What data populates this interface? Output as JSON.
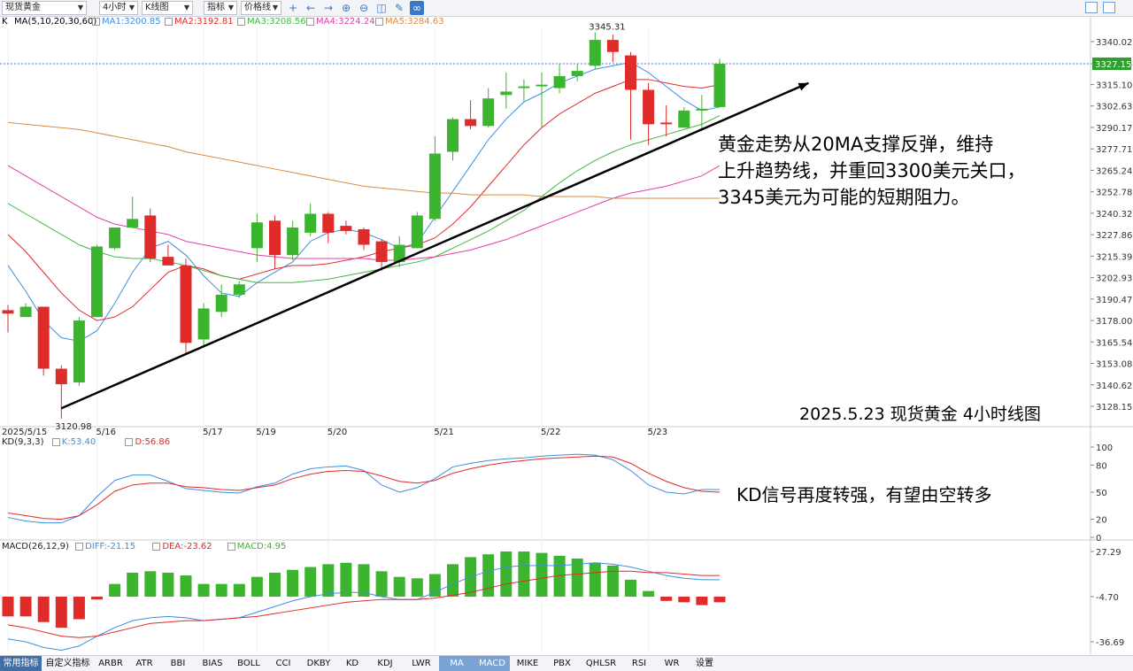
{
  "toolbar": {
    "symbol": "现货黄金",
    "period": "4小时",
    "chart_type": "K线图",
    "indicator": "指标",
    "price_line": "价格线"
  },
  "main_legend": {
    "k_label": "K",
    "ma_title": "MA(5,10,20,30,60)",
    "ma1": "MA1:3200.85",
    "ma2": "MA2:3192.81",
    "ma3": "MA3:3208.56",
    "ma4": "MA4:3224.24",
    "ma5": "MA5:3284.63"
  },
  "kd_legend": {
    "title": "KD(9,3,3)",
    "k": "K:53.40",
    "d": "D:56.86"
  },
  "macd_legend": {
    "title": "MACD(26,12,9)",
    "diff": "DIFF:-21.15",
    "dea": "DEA:-23.62",
    "macd": "MACD:4.95"
  },
  "annotations": {
    "main_text_1": "黄金走势从20MA支撑反弹，维持",
    "main_text_2": "上升趋势线，并重回3300美元关口，",
    "main_text_3": "3345美元为可能的短期阻力。",
    "chart_caption": "2025.5.23 现货黄金 4小时线图",
    "kd_text": "KD信号再度转强，有望由空转多"
  },
  "colors": {
    "up": "#3cb52e",
    "down": "#e02b2b",
    "ma1": "#3d8fe0",
    "ma2": "#e02b2b",
    "ma3": "#43b843",
    "ma4": "#e040a8",
    "ma5": "#d88a40"
  },
  "bottom_tabs": [
    "常用指标",
    "自定义指标",
    "ARBR",
    "ATR",
    "BBI",
    "BIAS",
    "BOLL",
    "CCI",
    "DKBY",
    "KD",
    "KDJ",
    "LWR",
    "MA",
    "MACD",
    "MIKE",
    "PBX",
    "QHLSR",
    "RSI",
    "WR",
    "设置"
  ],
  "chart_data": {
    "type": "candlestick",
    "title": "",
    "price_axis_ticks": [
      3340.02,
      3327.15,
      3315.1,
      3302.63,
      3290.17,
      3277.71,
      3265.24,
      3252.78,
      3240.32,
      3227.86,
      3215.39,
      3202.93,
      3190.47,
      3178.0,
      3165.54,
      3153.08,
      3140.62,
      3128.15
    ],
    "current_price": 3327.15,
    "high_label": "3345.31",
    "low_label": "3120.98",
    "date_labels": [
      {
        "label": "2025/5/15",
        "bar": 0
      },
      {
        "label": "5/16",
        "bar": 5
      },
      {
        "label": "5/17",
        "bar": 11
      },
      {
        "label": "5/19",
        "bar": 14
      },
      {
        "label": "5/20",
        "bar": 18
      },
      {
        "label": "5/21",
        "bar": 24
      },
      {
        "label": "5/22",
        "bar": 30
      },
      {
        "label": "5/23",
        "bar": 36
      }
    ],
    "candles": [
      {
        "o": 3184,
        "h": 3187,
        "l": 3171,
        "c": 3182
      },
      {
        "o": 3180,
        "h": 3188,
        "l": 3180,
        "c": 3186
      },
      {
        "o": 3186,
        "h": 3186,
        "l": 3146,
        "c": 3150
      },
      {
        "o": 3150,
        "h": 3152,
        "l": 3121,
        "c": 3141
      },
      {
        "o": 3142,
        "h": 3180,
        "l": 3140,
        "c": 3178
      },
      {
        "o": 3180,
        "h": 3222,
        "l": 3180,
        "c": 3221
      },
      {
        "o": 3220,
        "h": 3232,
        "l": 3219,
        "c": 3232
      },
      {
        "o": 3232,
        "h": 3250,
        "l": 3232,
        "c": 3237
      },
      {
        "o": 3239,
        "h": 3243,
        "l": 3212,
        "c": 3214
      },
      {
        "o": 3215,
        "h": 3222,
        "l": 3210,
        "c": 3210
      },
      {
        "o": 3210,
        "h": 3214,
        "l": 3158,
        "c": 3165
      },
      {
        "o": 3167,
        "h": 3188,
        "l": 3163,
        "c": 3185
      },
      {
        "o": 3183,
        "h": 3199,
        "l": 3180,
        "c": 3193
      },
      {
        "o": 3193,
        "h": 3201,
        "l": 3191,
        "c": 3199
      },
      {
        "o": 3220,
        "h": 3240,
        "l": 3212,
        "c": 3235
      },
      {
        "o": 3236,
        "h": 3239,
        "l": 3208,
        "c": 3216
      },
      {
        "o": 3216,
        "h": 3236,
        "l": 3213,
        "c": 3232
      },
      {
        "o": 3229,
        "h": 3246,
        "l": 3227,
        "c": 3240
      },
      {
        "o": 3240,
        "h": 3241,
        "l": 3223,
        "c": 3229
      },
      {
        "o": 3233,
        "h": 3236,
        "l": 3228,
        "c": 3230
      },
      {
        "o": 3231,
        "h": 3232,
        "l": 3219,
        "c": 3222
      },
      {
        "o": 3224,
        "h": 3225,
        "l": 3207,
        "c": 3212
      },
      {
        "o": 3212,
        "h": 3227,
        "l": 3209,
        "c": 3222
      },
      {
        "o": 3220,
        "h": 3241,
        "l": 3220,
        "c": 3239
      },
      {
        "o": 3237,
        "h": 3285,
        "l": 3236,
        "c": 3275
      },
      {
        "o": 3276,
        "h": 3296,
        "l": 3271,
        "c": 3295
      },
      {
        "o": 3295,
        "h": 3306,
        "l": 3289,
        "c": 3291
      },
      {
        "o": 3291,
        "h": 3313,
        "l": 3290,
        "c": 3307
      },
      {
        "o": 3309,
        "h": 3322,
        "l": 3301,
        "c": 3311
      },
      {
        "o": 3313,
        "h": 3318,
        "l": 3305,
        "c": 3314
      },
      {
        "o": 3314,
        "h": 3322,
        "l": 3290,
        "c": 3315
      },
      {
        "o": 3313,
        "h": 3327,
        "l": 3310,
        "c": 3320
      },
      {
        "o": 3320,
        "h": 3327,
        "l": 3317,
        "c": 3323
      },
      {
        "o": 3326,
        "h": 3345.31,
        "l": 3324,
        "c": 3341
      },
      {
        "o": 3341,
        "h": 3344,
        "l": 3328,
        "c": 3334
      },
      {
        "o": 3332,
        "h": 3334,
        "l": 3283,
        "c": 3312
      },
      {
        "o": 3312,
        "h": 3316,
        "l": 3280,
        "c": 3292
      },
      {
        "o": 3293,
        "h": 3303,
        "l": 3285,
        "c": 3292
      },
      {
        "o": 3290,
        "h": 3302,
        "l": 3290,
        "c": 3300
      },
      {
        "o": 3300,
        "h": 3309,
        "l": 3288,
        "c": 3301
      },
      {
        "o": 3302,
        "h": 3330,
        "l": 3302,
        "c": 3327.15
      }
    ],
    "ma_series": [
      {
        "name": "MA1",
        "values": [
          3210,
          3195,
          3178,
          3168,
          3166,
          3172,
          3188,
          3206,
          3220,
          3224,
          3216,
          3204,
          3194,
          3192,
          3200,
          3206,
          3212,
          3224,
          3229,
          3231,
          3229,
          3225,
          3220,
          3223,
          3238,
          3253,
          3268,
          3283,
          3295,
          3305,
          3310,
          3316,
          3320,
          3324,
          3326,
          3328,
          3322,
          3314,
          3306,
          3300,
          3302
        ]
      },
      {
        "name": "MA2",
        "values": [
          3228,
          3218,
          3206,
          3194,
          3184,
          3178,
          3180,
          3186,
          3196,
          3206,
          3210,
          3208,
          3204,
          3202,
          3205,
          3208,
          3210,
          3210,
          3211,
          3213,
          3215,
          3218,
          3220,
          3222,
          3226,
          3234,
          3244,
          3256,
          3268,
          3280,
          3290,
          3298,
          3304,
          3310,
          3314,
          3318,
          3318,
          3316,
          3314,
          3313,
          3315
        ]
      },
      {
        "name": "MA3",
        "values": [
          3246,
          3240,
          3234,
          3228,
          3222,
          3218,
          3215,
          3214,
          3214,
          3212,
          3210,
          3207,
          3204,
          3202,
          3200,
          3200,
          3200,
          3201,
          3202,
          3204,
          3206,
          3208,
          3210,
          3212,
          3215,
          3220,
          3225,
          3230,
          3236,
          3242,
          3250,
          3258,
          3265,
          3271,
          3276,
          3280,
          3283,
          3286,
          3289,
          3292,
          3297
        ]
      },
      {
        "name": "MA4",
        "values": [
          3268,
          3262,
          3256,
          3250,
          3244,
          3238,
          3234,
          3232,
          3230,
          3228,
          3224,
          3222,
          3220,
          3218,
          3216,
          3215,
          3214,
          3214,
          3214,
          3214,
          3214,
          3213,
          3213,
          3214,
          3215,
          3217,
          3219,
          3222,
          3225,
          3229,
          3233,
          3237,
          3241,
          3245,
          3249,
          3252,
          3254,
          3256,
          3259,
          3262,
          3268
        ]
      },
      {
        "name": "MA5",
        "values": [
          3293,
          3292,
          3291,
          3290,
          3289,
          3287,
          3285,
          3283,
          3281,
          3279,
          3276,
          3274,
          3272,
          3270,
          3268,
          3266,
          3264,
          3262,
          3260,
          3258,
          3256,
          3255,
          3254,
          3253,
          3252,
          3252,
          3251,
          3251,
          3251,
          3251,
          3250,
          3250,
          3250,
          3250,
          3249,
          3249,
          3249,
          3249,
          3249,
          3249,
          3249
        ]
      }
    ],
    "trendline": {
      "from": {
        "bar": 3,
        "price": 3127
      },
      "to": {
        "bar": 45,
        "price": 3316
      }
    },
    "kd": {
      "yticks": [
        100,
        80,
        50,
        20,
        0
      ],
      "k": [
        22,
        18,
        16,
        16,
        24,
        45,
        63,
        69,
        69,
        62,
        54,
        52,
        50,
        49,
        56,
        60,
        70,
        76,
        78,
        79,
        74,
        58,
        50,
        55,
        65,
        78,
        82,
        85,
        87,
        88,
        90,
        91,
        92,
        91,
        86,
        74,
        58,
        50,
        48,
        53,
        53
      ],
      "d": [
        27,
        24,
        21,
        20,
        24,
        36,
        51,
        58,
        60,
        60,
        56,
        55,
        53,
        52,
        55,
        58,
        65,
        70,
        73,
        74,
        73,
        68,
        62,
        60,
        63,
        71,
        76,
        80,
        83,
        85,
        87,
        88,
        89,
        90,
        89,
        82,
        71,
        62,
        55,
        51,
        50
      ]
    },
    "macd": {
      "yticks": [
        27.29,
        -4.7,
        -36.69
      ],
      "hist": [
        -14,
        -14,
        -18,
        -22,
        -16,
        -2,
        9,
        17,
        18,
        17,
        15,
        9,
        9,
        9,
        14,
        17,
        19,
        21,
        23,
        24,
        23,
        18,
        14,
        13,
        16,
        23,
        28,
        30,
        32,
        32,
        31,
        29,
        27,
        24,
        22,
        12,
        4,
        -3,
        -4,
        -6,
        -4
      ],
      "diff": [
        -30,
        -32,
        -36,
        -38,
        -35,
        -28,
        -22,
        -17,
        -15,
        -14,
        -15,
        -17,
        -16,
        -15,
        -11,
        -7,
        -3,
        0,
        2,
        3,
        3,
        0,
        -2,
        -2,
        3,
        9,
        14,
        18,
        21,
        22,
        22,
        22,
        23,
        24,
        23,
        21,
        18,
        15,
        13,
        12,
        12
      ],
      "dea": [
        -20,
        -22,
        -25,
        -28,
        -29,
        -28,
        -25,
        -22,
        -19,
        -18,
        -17,
        -17,
        -16,
        -15,
        -14,
        -12,
        -10,
        -8,
        -6,
        -4,
        -3,
        -2,
        -2,
        -2,
        -1,
        1,
        3,
        6,
        9,
        11,
        13,
        15,
        16,
        17,
        18,
        18,
        17,
        17,
        16,
        15,
        15
      ]
    }
  }
}
